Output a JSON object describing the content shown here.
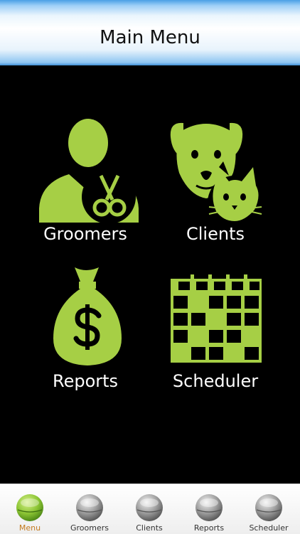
{
  "header": {
    "title": "Main Menu"
  },
  "menu": {
    "groomers": "Groomers",
    "clients": "Clients",
    "reports": "Reports",
    "scheduler": "Scheduler"
  },
  "tabs": [
    {
      "label": "Menu",
      "active": true
    },
    {
      "label": "Groomers",
      "active": false
    },
    {
      "label": "Clients",
      "active": false
    },
    {
      "label": "Reports",
      "active": false
    },
    {
      "label": "Scheduler",
      "active": false
    }
  ],
  "colors": {
    "accent": "#a6cf45",
    "active_tab": "#c47a1e",
    "header_blue": "#4aa0e6"
  },
  "icons": [
    "groomer-scissors-icon",
    "dog-cat-icon",
    "money-bag-icon",
    "calendar-grid-icon",
    "ball-icon"
  ]
}
